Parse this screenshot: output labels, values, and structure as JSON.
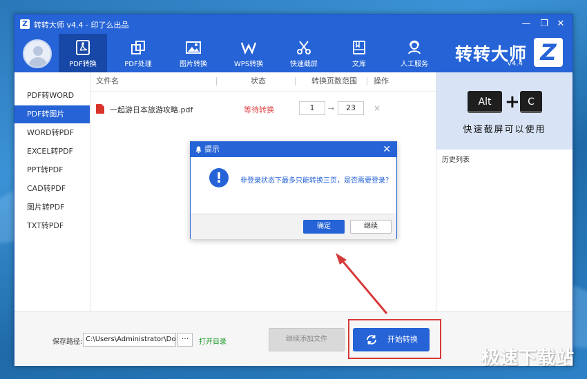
{
  "app": {
    "title": "转转大师 v4.4 - 印了么出品"
  },
  "nav": [
    {
      "label": "PDF转换",
      "icon": "pdf-icon"
    },
    {
      "label": "PDF处理",
      "icon": "pdf-process-icon"
    },
    {
      "label": "图片转换",
      "icon": "image-icon"
    },
    {
      "label": "WPS转换",
      "icon": "wps-icon"
    },
    {
      "label": "快速截屏",
      "icon": "scissors-icon"
    },
    {
      "label": "文库",
      "icon": "library-icon"
    },
    {
      "label": "人工服务",
      "icon": "support-icon"
    }
  ],
  "brand": {
    "name": "转转大师",
    "version": "V4.4",
    "logo_letter": "Z"
  },
  "sidebar": {
    "items": [
      "PDF转WORD",
      "PDF转图片",
      "WORD转PDF",
      "EXCEL转PDF",
      "PPT转PDF",
      "CAD转PDF",
      "图片转PDF",
      "TXT转PDF"
    ],
    "active_index": 1
  },
  "table": {
    "headers": {
      "filename": "文件名",
      "status": "状态",
      "range": "转换页数范围",
      "action": "操作"
    },
    "row": {
      "filename": "一起游日本旅游攻略.pdf",
      "status": "等待转换",
      "from": "1",
      "to": "23",
      "remove": "×",
      "arrow": "→"
    }
  },
  "promo": {
    "key1": "Alt",
    "plus": "+",
    "key2": "C",
    "text": "快速截屏可以使用"
  },
  "history": {
    "title": "历史列表"
  },
  "footer": {
    "save_label": "保存路径:",
    "save_path": "C:\\Users\\Administrator\\Documents",
    "browse_label": "···",
    "open_dir": "打开目录",
    "add_files": "继续添加文件",
    "start": "开始转换"
  },
  "dialog": {
    "title": "提示",
    "close": "✕",
    "alert": "!",
    "message": "非登录状态下最多只能转换三页，是否需要登录？",
    "ok": "确定",
    "continue": "继续"
  },
  "watermark": "极速下载站",
  "colors": {
    "primary": "#2563d6",
    "annotation": "#d63a3a",
    "status_waiting": "#e04646"
  }
}
